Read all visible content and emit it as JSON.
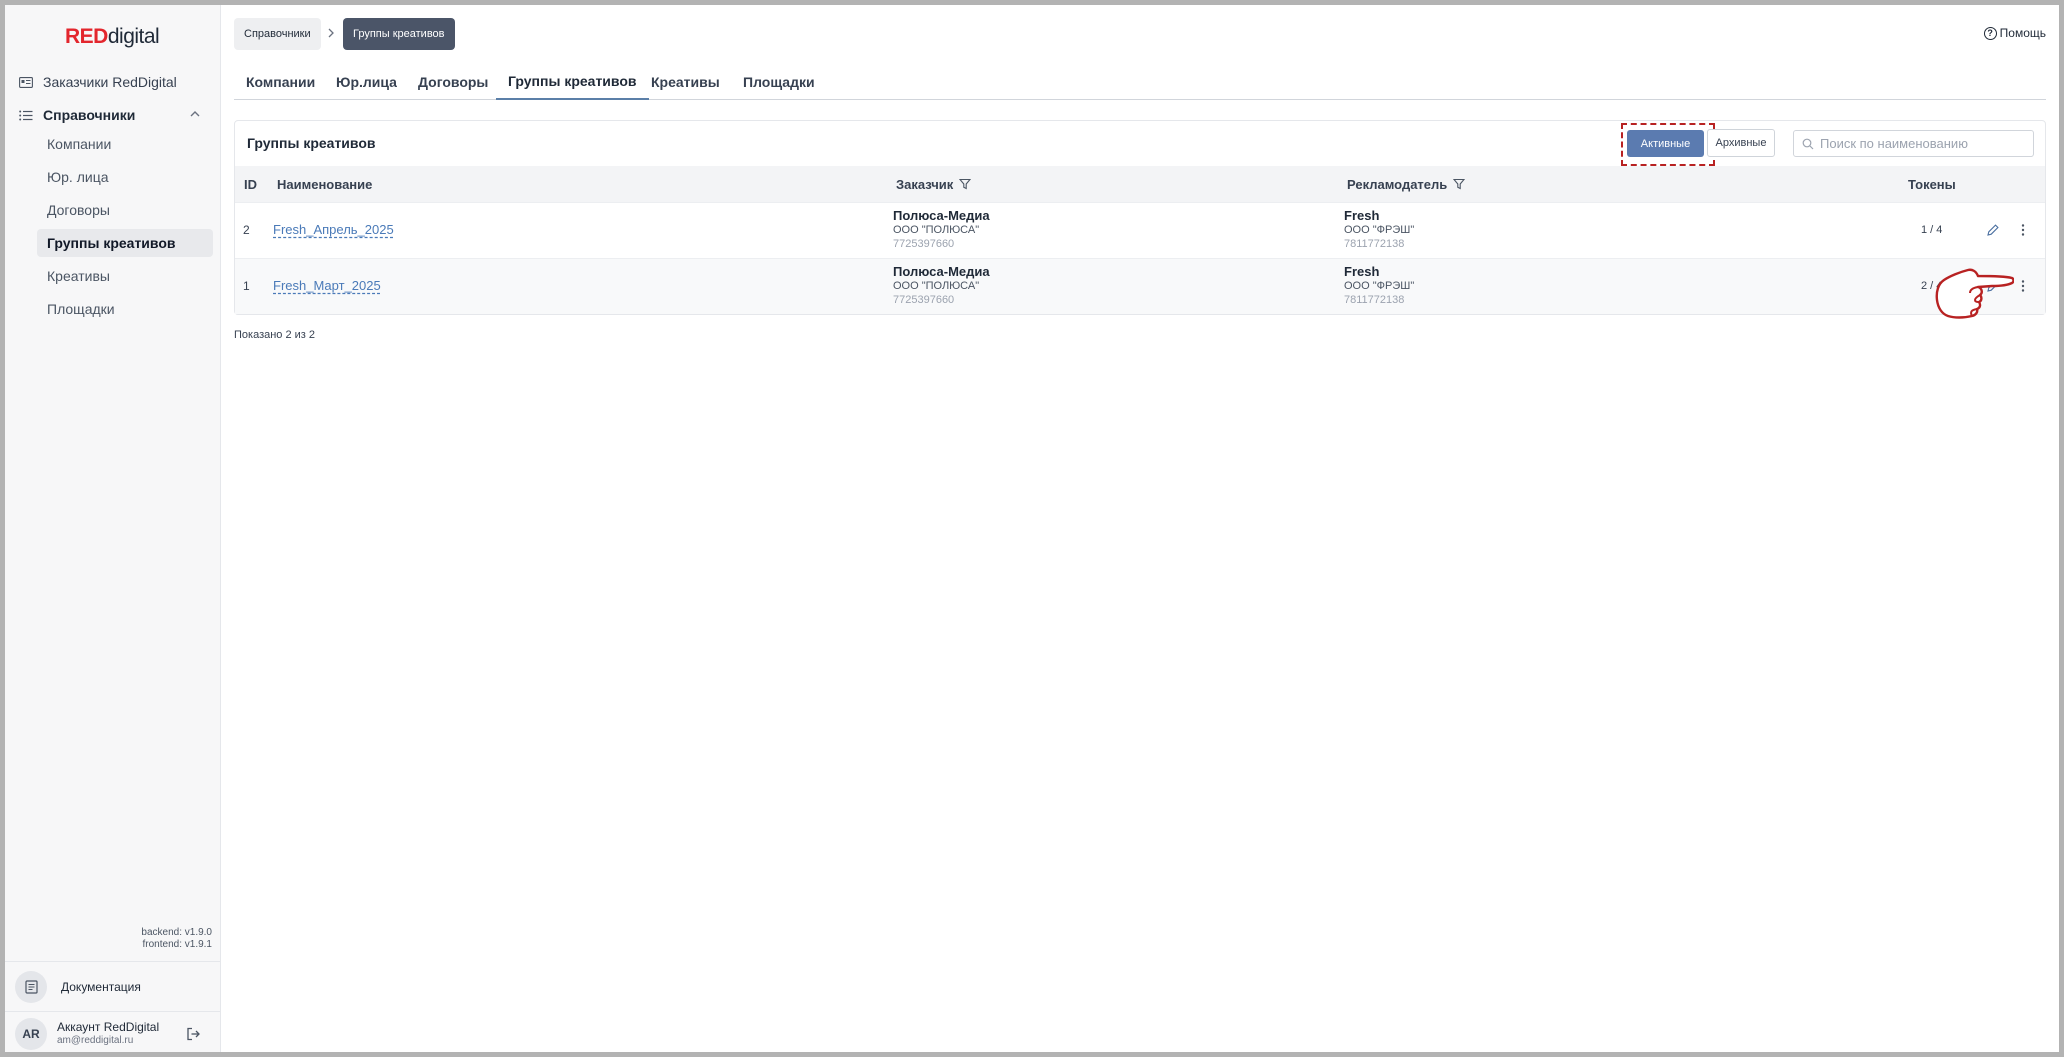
{
  "brand": {
    "part1": "RED",
    "part2": "digital"
  },
  "sidebar": {
    "top_item": "Заказчики RedDigital",
    "group": "Справочники",
    "items": [
      {
        "label": "Компании",
        "active": false
      },
      {
        "label": "Юр. лица",
        "active": false
      },
      {
        "label": "Договоры",
        "active": false
      },
      {
        "label": "Группы креативов",
        "active": true
      },
      {
        "label": "Креативы",
        "active": false
      },
      {
        "label": "Площадки",
        "active": false
      }
    ],
    "versions": {
      "backend": "backend: v1.9.0",
      "frontend": "frontend: v1.9.1"
    },
    "docs": "Документация",
    "account": {
      "initials": "AR",
      "name": "Аккаунт RedDigital",
      "email": "am@reddigital.ru"
    }
  },
  "breadcrumb": [
    "Справочники",
    "Группы креативов"
  ],
  "help": "Помощь",
  "tabs": [
    {
      "label": "Компании",
      "active": false
    },
    {
      "label": "Юр.лица",
      "active": false
    },
    {
      "label": "Договоры",
      "active": false
    },
    {
      "label": "Группы креативов",
      "active": true
    },
    {
      "label": "Креативы",
      "active": false
    },
    {
      "label": "Площадки",
      "active": false
    }
  ],
  "card": {
    "title": "Группы креативов",
    "filters": {
      "active": "Активные",
      "archive": "Архивные"
    },
    "search_placeholder": "Поиск по наименованию"
  },
  "table": {
    "headers": {
      "id": "ID",
      "name": "Наименование",
      "customer": "Заказчик",
      "advertiser": "Рекламодатель",
      "tokens": "Токены"
    },
    "rows": [
      {
        "id": "2",
        "name": "Fresh_Апрель_2025",
        "customer": {
          "name": "Полюса-Медиа",
          "legal": "ООО \"ПОЛЮСА\"",
          "inn": "7725397660"
        },
        "advertiser": {
          "name": "Fresh",
          "legal": "ООО \"ФРЭШ\"",
          "inn": "7811772138"
        },
        "tokens": "1 / 4"
      },
      {
        "id": "1",
        "name": "Fresh_Март_2025",
        "customer": {
          "name": "Полюса-Медиа",
          "legal": "ООО \"ПОЛЮСА\"",
          "inn": "7725397660"
        },
        "advertiser": {
          "name": "Fresh",
          "legal": "ООО \"ФРЭШ\"",
          "inn": "7811772138"
        },
        "tokens": "2 / 4"
      }
    ]
  },
  "footer": {
    "shown": "Показано 2 из 2"
  },
  "colors": {
    "accent": "#5b7bb0",
    "brand_red": "#e3262d",
    "link": "#4a7ab8",
    "highlight": "#b82222"
  }
}
